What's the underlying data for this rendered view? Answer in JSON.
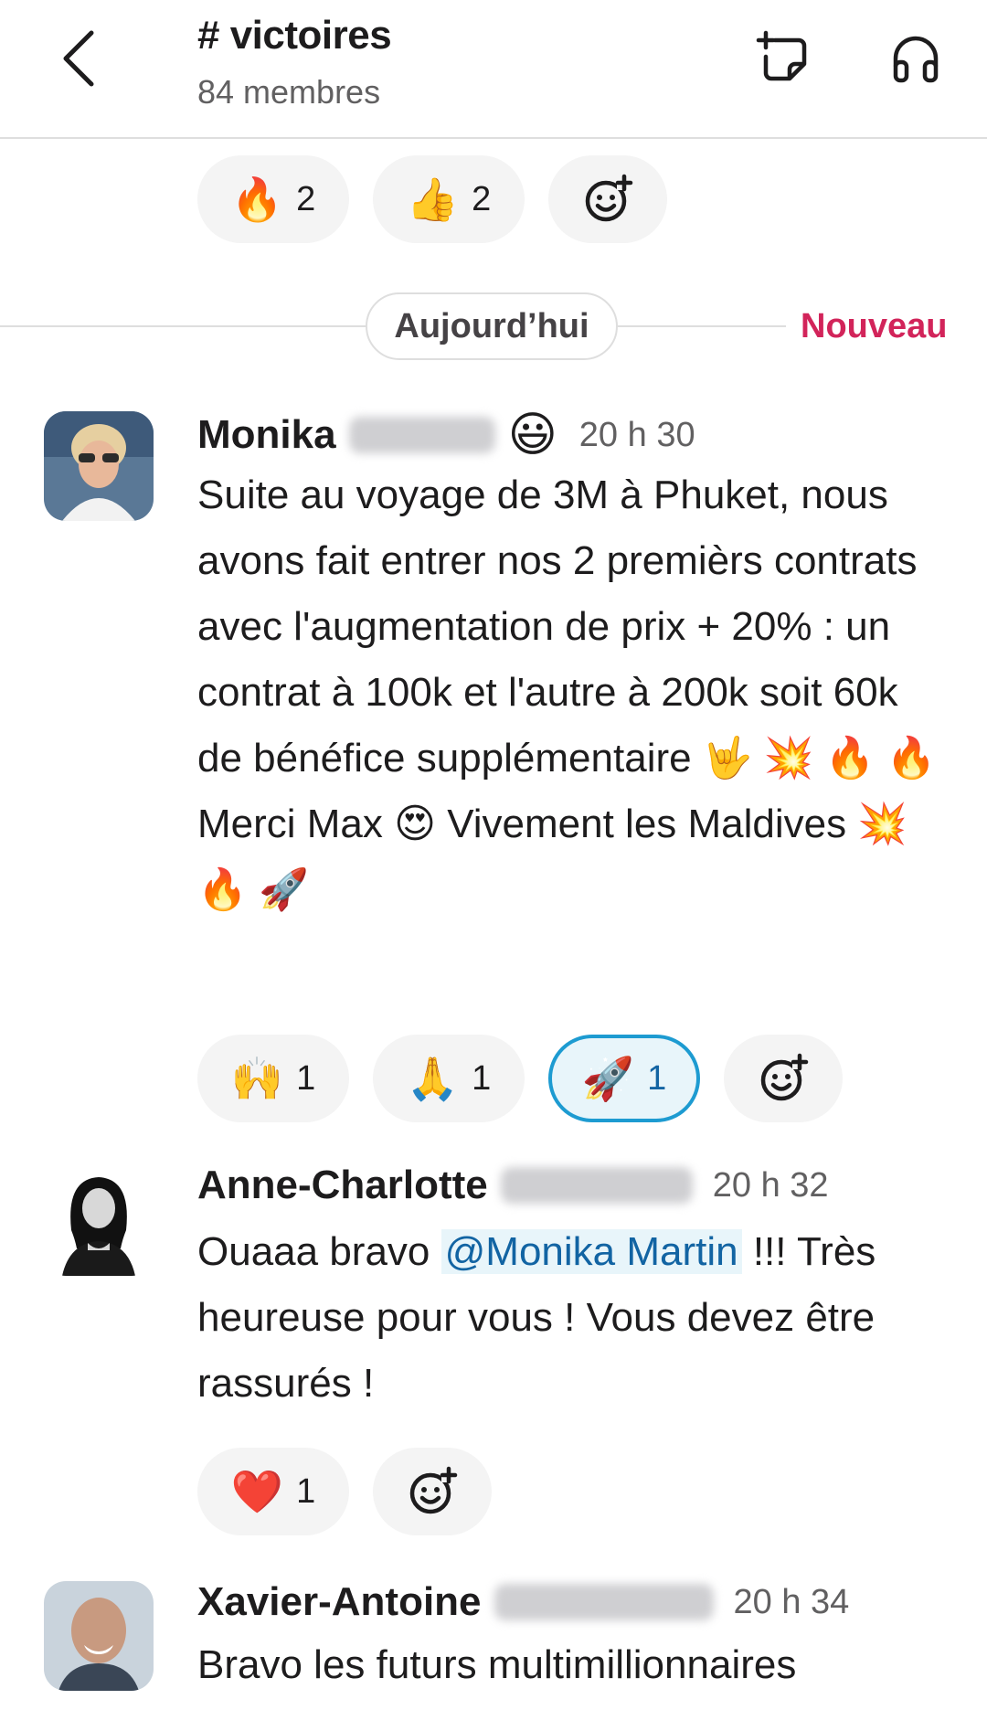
{
  "header": {
    "channel_title": "# victoires",
    "member_count": "84 membres"
  },
  "top_reactions": [
    {
      "emoji": "🔥",
      "count": "2"
    },
    {
      "emoji": "👍",
      "count": "2"
    }
  ],
  "divider": {
    "day_label": "Aujourd’hui",
    "new_label": "Nouveau"
  },
  "messages": [
    {
      "author": "Monika",
      "status_emoji": "😃",
      "time": "20 h 30",
      "body": "Suite au voyage de 3M à Phuket, nous avons fait entrer nos 2 premièrs contrats avec l'augmentation de prix + 20% : un contrat à 100k et l'autre à 200k soit 60k de bénéfice supplémentaire 🤟 💥 🔥 🔥 Merci Max 😍 Vivement les  Maldives 💥 🔥 🚀",
      "reactions": [
        {
          "emoji": "🙌",
          "count": "1"
        },
        {
          "emoji": "🙏",
          "count": "1"
        },
        {
          "emoji": "🚀",
          "count": "1"
        }
      ]
    },
    {
      "author": "Anne-Charlotte",
      "time": "20 h 32",
      "body_before": "Ouaaa bravo ",
      "mention": "@Monika Martin",
      "body_after": " !!! Très heureuse pour vous ! Vous devez être rassurés !",
      "reactions": [
        {
          "emoji": "❤️",
          "count": "1"
        }
      ]
    },
    {
      "author": "Xavier-Antoine",
      "time": "20 h 34",
      "body": "Bravo les futurs multimillionnaires"
    }
  ],
  "colors": {
    "accent_new": "#d2245a",
    "mention_bg": "#e8f5fa",
    "mention_text": "#1264a3",
    "active_reaction_border": "#1d9bd1",
    "pill_bg": "#f4f4f4"
  },
  "icons": {
    "back": "chevron-left-icon",
    "new_canvas": "add-note-icon",
    "huddle": "headphones-icon",
    "add_reaction": "add-reaction-icon"
  }
}
